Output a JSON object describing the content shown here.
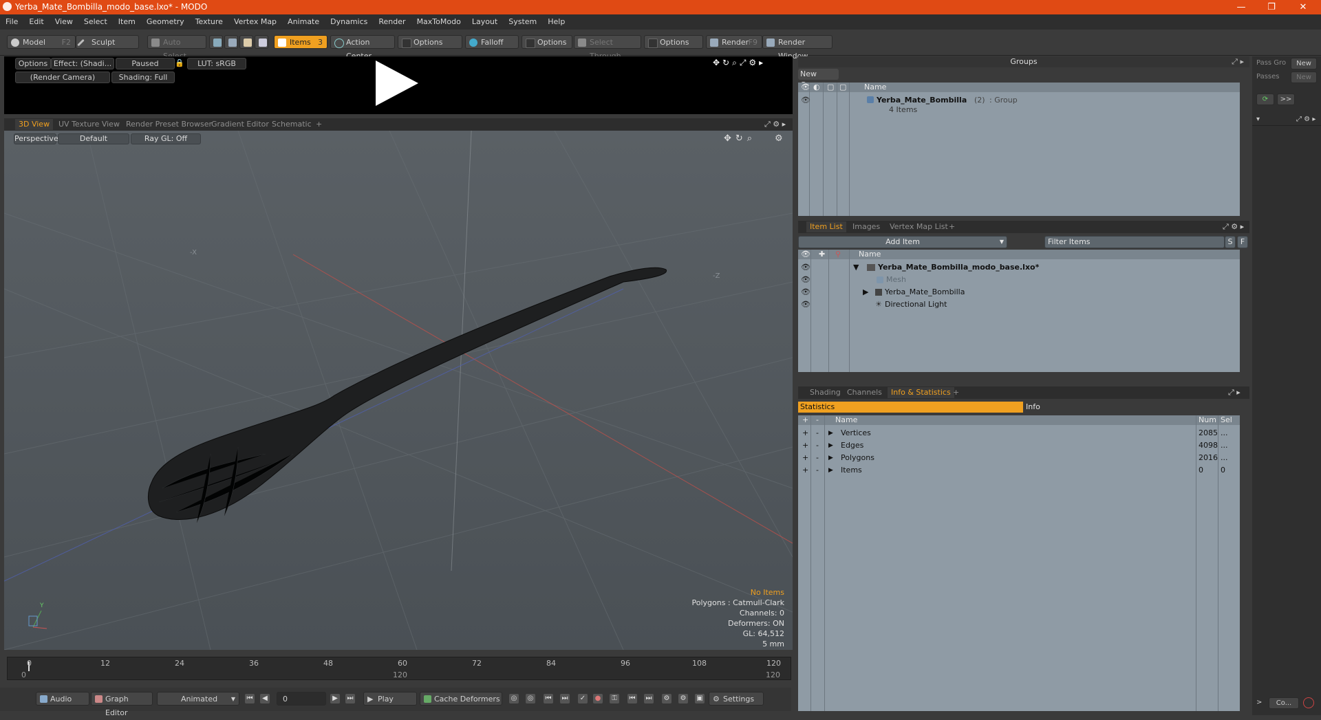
{
  "window": {
    "title": "Yerba_Mate_Bombilla_modo_base.lxo* - MODO",
    "minimize": "—",
    "maximize": "❐",
    "close": "✕"
  },
  "menu": [
    "File",
    "Edit",
    "View",
    "Select",
    "Item",
    "Geometry",
    "Texture",
    "Vertex Map",
    "Animate",
    "Dynamics",
    "Render",
    "MaxToModo",
    "Layout",
    "System",
    "Help"
  ],
  "toolbar": {
    "model": "Model",
    "model_key": "F2",
    "sculpt": "Sculpt",
    "auto_select": "Auto Select",
    "items": "Items",
    "items_key": "3",
    "action_center": "Action Center",
    "options1": "Options",
    "falloff": "Falloff",
    "options2": "Options",
    "select_through": "Select Through",
    "options3": "Options",
    "render": "Render",
    "render_key": "F9",
    "render_window": "Render Window"
  },
  "preview": {
    "options": "Options",
    "effect": "Effect: (Shadi...",
    "paused": "Paused",
    "lut": "LUT: sRGB",
    "camera": "(Render Camera)",
    "shading": "Shading: Full"
  },
  "viewport_tabs": [
    "3D View",
    "UV Texture View",
    "Render Preset Browser",
    "Gradient Editor",
    "Schematic",
    "+"
  ],
  "viewport": {
    "perspective": "Perspective",
    "default": "Default",
    "raygl": "Ray GL: Off",
    "axis_neg_x": "-X",
    "axis_neg_z": "-Z",
    "axis_y": "Y",
    "info": {
      "no_items": "No Items",
      "polygons": "Polygons : Catmull-Clark",
      "channels": "Channels: 0",
      "deformers": "Deformers: ON",
      "gl": "GL: 64,512",
      "unit": "5 mm"
    }
  },
  "timeline": {
    "ticks": [
      "0",
      "12",
      "24",
      "36",
      "48",
      "60",
      "72",
      "84",
      "96",
      "108",
      "120"
    ],
    "range_start": "0",
    "range_mid": "120",
    "range_end": "120"
  },
  "bottombar": {
    "audio": "Audio",
    "graph_editor": "Graph Editor",
    "animated": "Animated",
    "frame": "0",
    "play": "Play",
    "cache_deformers": "Cache Deformers",
    "settings": "Settings"
  },
  "groups": {
    "title": "Groups",
    "new_group": "New Group",
    "col_name": "Name",
    "row_name": "Yerba_Mate_Bombilla",
    "row_count": "(2)",
    "row_type": ": Group",
    "row_items": "4 Items"
  },
  "itemlist": {
    "tabs": [
      "Item List",
      "Images",
      "Vertex Map List",
      "+"
    ],
    "add_item": "Add Item",
    "filter_placeholder": "Filter Items",
    "s_btn": "S",
    "f_btn": "F",
    "col_name": "Name",
    "rows": [
      {
        "name": "Yerba_Mate_Bombilla_modo_base.lxo*"
      },
      {
        "name": "Mesh"
      },
      {
        "name": "Yerba_Mate_Bombilla"
      },
      {
        "name": "Directional Light"
      }
    ]
  },
  "stats": {
    "tabs": [
      "Shading",
      "Channels",
      "Info & Statistics",
      "+"
    ],
    "statistics": "Statistics",
    "info": "Info",
    "col_name": "Name",
    "col_num": "Num",
    "col_sel": "Sel",
    "rows": [
      {
        "name": "Vertices",
        "num": "2085",
        "sel": "..."
      },
      {
        "name": "Edges",
        "num": "4098",
        "sel": "..."
      },
      {
        "name": "Polygons",
        "num": "2016",
        "sel": "..."
      },
      {
        "name": "Items",
        "num": "0",
        "sel": "0"
      }
    ]
  },
  "farright": {
    "pass_group": "Pass Gro",
    "passes": "Passes",
    "new1": "New",
    "new2": "New",
    "more": ">>",
    "co": "Co..."
  }
}
